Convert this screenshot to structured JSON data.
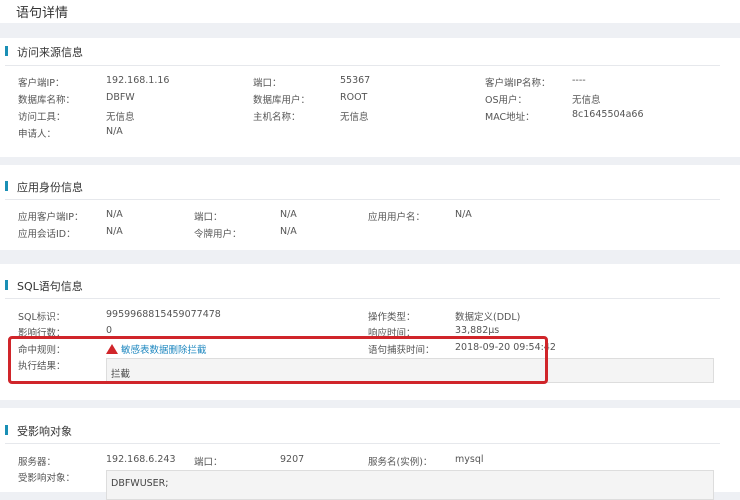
{
  "page_title": "语句详情",
  "source": {
    "heading": "访问来源信息",
    "rows": [
      [
        [
          "客户端IP：",
          "192.168.1.16"
        ],
        [
          "端口：",
          "55367"
        ],
        [
          "客户端IP名称：",
          "----"
        ]
      ],
      [
        [
          "数据库名称：",
          "DBFW"
        ],
        [
          "数据库用户：",
          "ROOT"
        ],
        [
          "OS用户：",
          "无信息"
        ]
      ],
      [
        [
          "访问工具：",
          "无信息"
        ],
        [
          "主机名称：",
          "无信息"
        ],
        [
          "MAC地址：",
          "8c1645504a66"
        ]
      ],
      [
        [
          "申请人：",
          "N/A"
        ]
      ]
    ]
  },
  "app": {
    "heading": "应用身份信息",
    "rows": [
      [
        [
          "应用客户端IP：",
          "N/A"
        ],
        [
          "端口：",
          "N/A"
        ],
        [
          "应用用户名：",
          "N/A"
        ]
      ],
      [
        [
          "应用会话ID：",
          "N/A"
        ],
        [
          "令牌用户：",
          "N/A"
        ]
      ]
    ]
  },
  "sql": {
    "heading": "SQL语句信息",
    "id_label": "SQL标识：",
    "id": "9959968815459077478",
    "op_label": "操作类型：",
    "op": "数据定义(DDL)",
    "rows_label": "影响行数：",
    "rows": "0",
    "resp_label": "响应时间：",
    "resp": "33,882μs",
    "rule_label": "命中规则：",
    "rule": "敏感表数据删除拦截",
    "time_label": "语句捕获时间：",
    "time": "2018-09-20 09:54:42",
    "result_label": "执行结果：",
    "result": "拦截"
  },
  "affected": {
    "heading": "受影响对象",
    "server_label": "服务器：",
    "server": "192.168.6.243",
    "port_label": "端口：",
    "port": "9207",
    "svc_label": "服务名(实例)：",
    "svc": "mysql",
    "obj_label": "受影响对象：",
    "obj": "DBFWUSER;"
  }
}
